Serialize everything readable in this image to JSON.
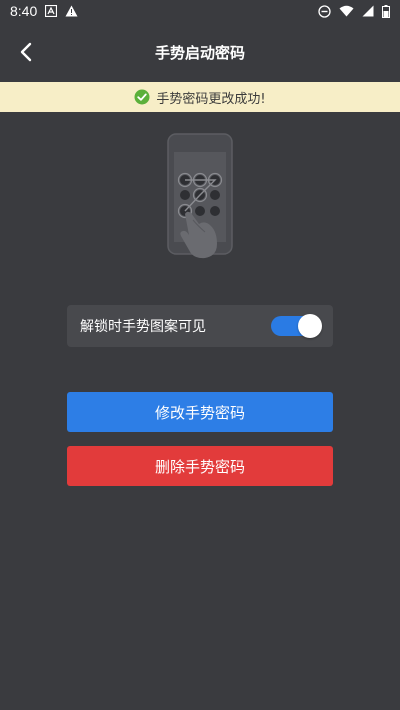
{
  "status_bar": {
    "time": "8:40",
    "left_icons": [
      "a-box-icon",
      "warning-icon"
    ],
    "right_icons": [
      "do-not-disturb-icon",
      "wifi-icon",
      "signal-icon",
      "battery-icon"
    ]
  },
  "app_bar": {
    "title": "手势启动密码",
    "back_icon": "chevron-left-icon"
  },
  "banner": {
    "message": "手势密码更改成功!",
    "icon": "check-circle-icon",
    "icon_color": "#5bb03a",
    "background": "#f7eec7"
  },
  "toggle": {
    "label": "解锁时手势图案可见",
    "enabled": true,
    "accent": "#2a7be4"
  },
  "buttons": {
    "modify": "修改手势密码",
    "delete": "删除手势密码",
    "modify_color": "#2d7ee6",
    "delete_color": "#e23b3b"
  }
}
